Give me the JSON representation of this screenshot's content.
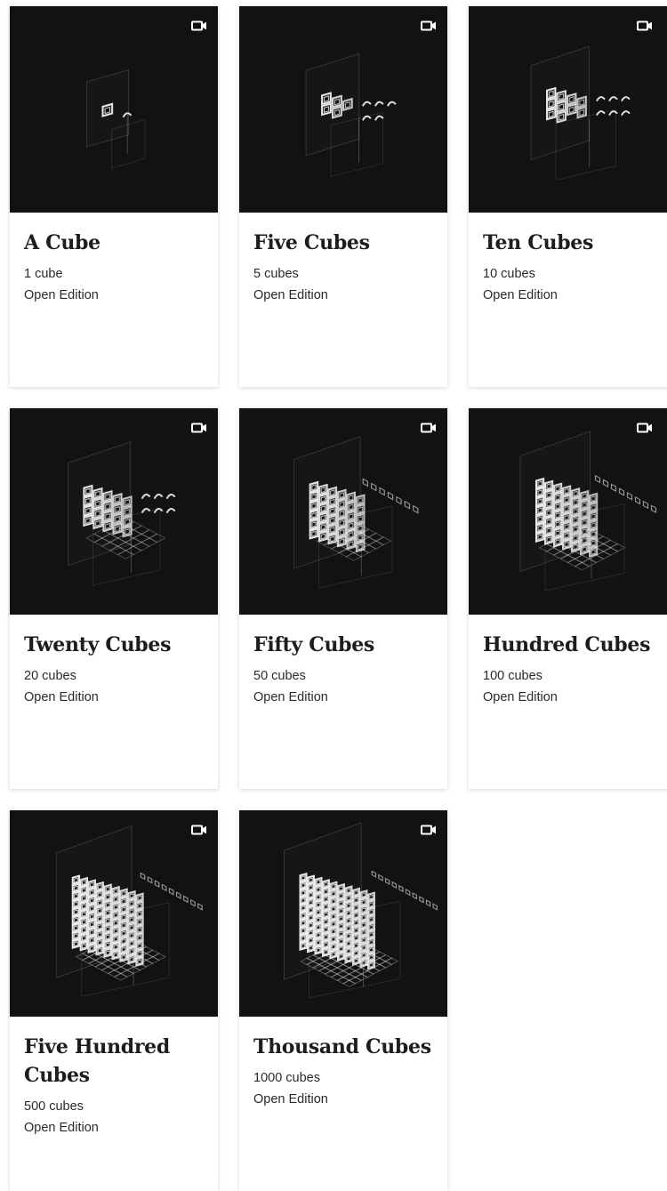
{
  "cards": [
    {
      "title": "A Cube",
      "count": "1 cube",
      "edition": "Open Edition",
      "cubes": 1,
      "media": "video-icon"
    },
    {
      "title": "Five Cubes",
      "count": "5 cubes",
      "edition": "Open Edition",
      "cubes": 5,
      "media": "video-icon"
    },
    {
      "title": "Ten Cubes",
      "count": "10 cubes",
      "edition": "Open Edition",
      "cubes": 10,
      "media": "video-icon"
    },
    {
      "title": "Twenty Cubes",
      "count": "20 cubes",
      "edition": "Open Edition",
      "cubes": 20,
      "media": "video-icon"
    },
    {
      "title": "Fifty Cubes",
      "count": "50 cubes",
      "edition": "Open Edition",
      "cubes": 50,
      "media": "video-icon"
    },
    {
      "title": "Hundred Cubes",
      "count": "100 cubes",
      "edition": "Open Edition",
      "cubes": 100,
      "media": "video-icon"
    },
    {
      "title": "Five Hundred Cubes",
      "count": "500 cubes",
      "edition": "Open Edition",
      "cubes": 500,
      "media": "video-icon"
    },
    {
      "title": "Thousand Cubes",
      "count": "1000 cubes",
      "edition": "Open Edition",
      "cubes": 1000,
      "media": "video-icon"
    }
  ],
  "colors": {
    "thumb_background": "#121212",
    "cube_outline": "#f2f2f2",
    "card_background": "#ffffff",
    "text": "#1d1d1d"
  }
}
